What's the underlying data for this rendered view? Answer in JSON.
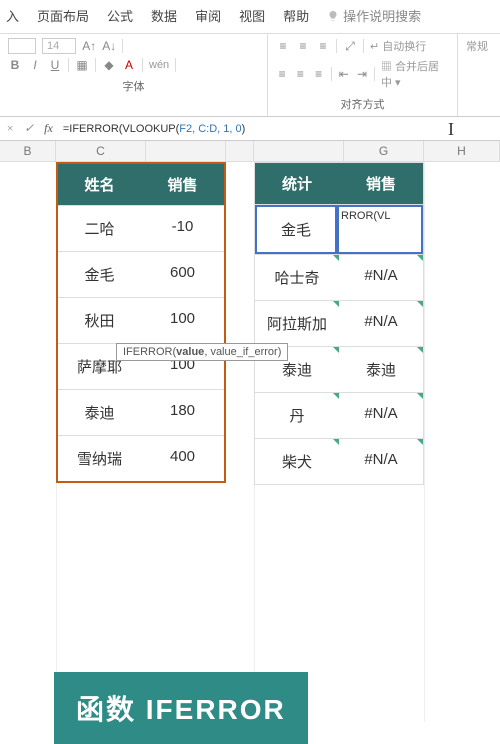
{
  "tabs": {
    "t0": "入",
    "t1": "页面布局",
    "t2": "公式",
    "t3": "数据",
    "t4": "审阅",
    "t5": "视图",
    "t6": "帮助",
    "search": "操作说明搜索"
  },
  "ribbon": {
    "fontSize": "14",
    "groupFont": "字体",
    "groupAlign": "对齐方式",
    "wrap": "自动换行",
    "merge": "合并后居中",
    "num": "常规"
  },
  "formula": {
    "cancel": "×",
    "confirm": "✓",
    "fx": "fx",
    "prefix": "=IFERROR(VLOOKUP(",
    "args": "F2, C:D, 1, 0",
    "suffix": ")"
  },
  "tooltip": {
    "fn": "IFERROR",
    "a1": "value",
    "a2": "value_if_error"
  },
  "cols": {
    "B": "B",
    "C": "C",
    "G": "G",
    "H": "H"
  },
  "table1": {
    "h1": "姓名",
    "h2": "销售",
    "rows": [
      {
        "n": "二哈",
        "v": "-10"
      },
      {
        "n": "金毛",
        "v": "600"
      },
      {
        "n": "秋田",
        "v": "100"
      },
      {
        "n": "萨摩耶",
        "v": "100"
      },
      {
        "n": "泰迪",
        "v": "180"
      },
      {
        "n": "雪纳瑞",
        "v": "400"
      }
    ]
  },
  "table2": {
    "h1": "统计",
    "h2": "销售",
    "rows": [
      {
        "n": "金毛",
        "v": "RROR(VL",
        "edit": true
      },
      {
        "n": "哈士奇",
        "v": "#N/A"
      },
      {
        "n": "阿拉斯加",
        "v": "#N/A"
      },
      {
        "n": "泰迪",
        "v": "泰迪"
      },
      {
        "n": "丹",
        "v": "#N/A"
      },
      {
        "n": "柴犬",
        "v": "#N/A"
      }
    ]
  },
  "banner": "函数 IFERROR"
}
